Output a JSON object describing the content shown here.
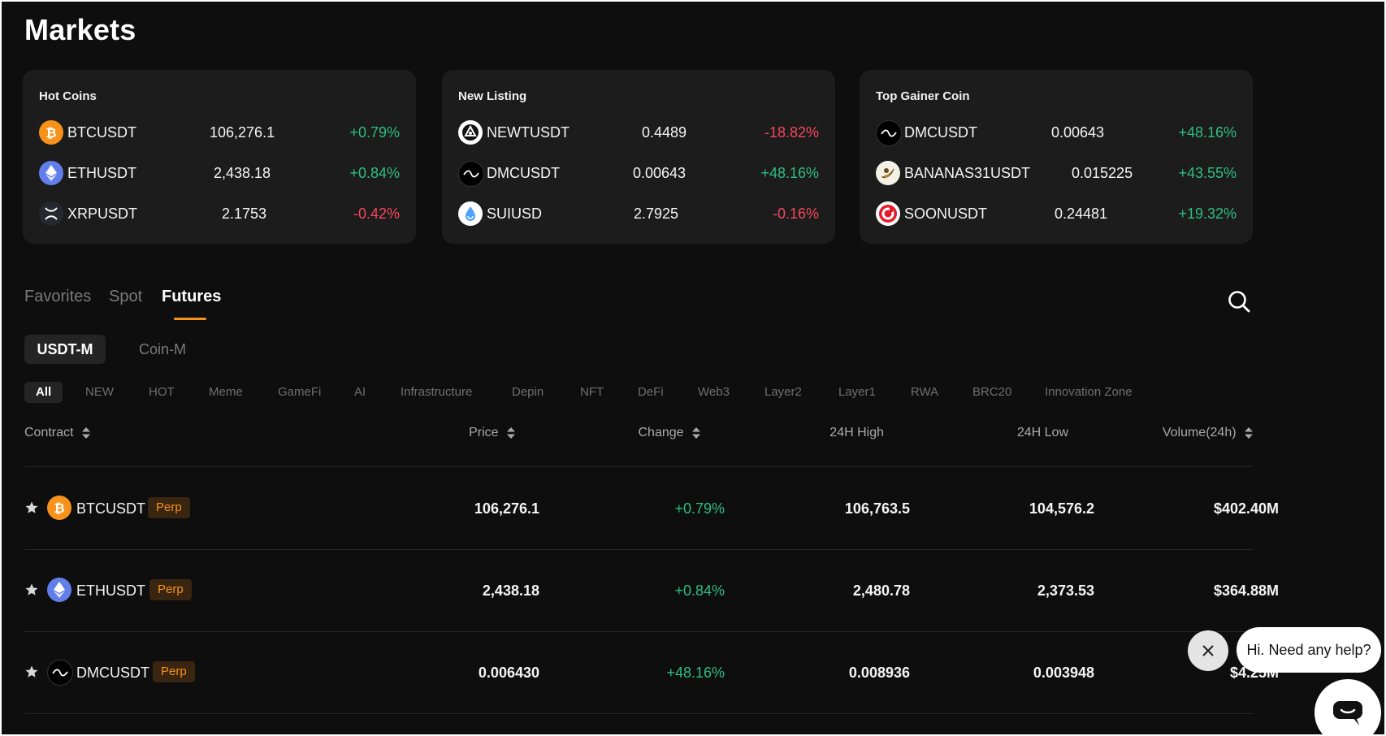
{
  "page": {
    "title": "Markets"
  },
  "cards": [
    {
      "title": "Hot Coins",
      "rows": [
        {
          "symbol": "BTCUSDT",
          "price": "106,276.1",
          "change": "+0.79%",
          "dir": "up",
          "icon": "bitcoin-icon"
        },
        {
          "symbol": "ETHUSDT",
          "price": "2,438.18",
          "change": "+0.84%",
          "dir": "up",
          "icon": "ethereum-icon"
        },
        {
          "symbol": "XRPUSDT",
          "price": "2.1753",
          "change": "-0.42%",
          "dir": "down",
          "icon": "xrp-icon"
        }
      ]
    },
    {
      "title": "New Listing",
      "rows": [
        {
          "symbol": "NEWTUSDT",
          "price": "0.4489",
          "change": "-18.82%",
          "dir": "down",
          "icon": "newt-icon"
        },
        {
          "symbol": "DMCUSDT",
          "price": "0.00643",
          "change": "+48.16%",
          "dir": "up",
          "icon": "dmc-icon"
        },
        {
          "symbol": "SUIUSD",
          "price": "2.7925",
          "change": "-0.16%",
          "dir": "down",
          "icon": "sui-icon"
        }
      ]
    },
    {
      "title": "Top Gainer Coin",
      "rows": [
        {
          "symbol": "DMCUSDT",
          "price": "0.00643",
          "change": "+48.16%",
          "dir": "up",
          "icon": "dmc-icon"
        },
        {
          "symbol": "BANANAS31USDT",
          "price": "0.015225",
          "change": "+43.55%",
          "dir": "up",
          "icon": "bananas31-icon"
        },
        {
          "symbol": "SOONUSDT",
          "price": "0.24481",
          "change": "+19.32%",
          "dir": "up",
          "icon": "soon-icon"
        }
      ]
    }
  ],
  "tabs": [
    {
      "label": "Favorites",
      "active": false
    },
    {
      "label": "Spot",
      "active": false
    },
    {
      "label": "Futures",
      "active": true
    }
  ],
  "segments": [
    {
      "label": "USDT-M",
      "active": true
    },
    {
      "label": "Coin-M",
      "active": false
    }
  ],
  "categories": [
    "All",
    "NEW",
    "HOT",
    "Meme",
    "GameFi",
    "AI",
    "Infrastructure",
    "Depin",
    "NFT",
    "DeFi",
    "Web3",
    "Layer2",
    "Layer1",
    "RWA",
    "BRC20",
    "Innovation Zone"
  ],
  "table": {
    "headers": {
      "contract": "Contract",
      "price": "Price",
      "change": "Change",
      "high": "24H High",
      "low": "24H Low",
      "volume": "Volume(24h)"
    },
    "perp_label": "Perp",
    "rows": [
      {
        "symbol": "BTCUSDT",
        "price": "106,276.1",
        "change": "+0.79%",
        "high": "106,763.5",
        "low": "104,576.2",
        "volume": "$402.40M",
        "icon": "bitcoin-icon"
      },
      {
        "symbol": "ETHUSDT",
        "price": "2,438.18",
        "change": "+0.84%",
        "high": "2,480.78",
        "low": "2,373.53",
        "volume": "$364.88M",
        "icon": "ethereum-icon"
      },
      {
        "symbol": "DMCUSDT",
        "price": "0.006430",
        "change": "+48.16%",
        "high": "0.008936",
        "low": "0.003948",
        "volume": "$4.25M",
        "icon": "dmc-icon"
      }
    ]
  },
  "help": {
    "message": "Hi. Need any help?"
  },
  "colors": {
    "up": "#2ebd85",
    "down": "#f6465d",
    "accent": "#f7931a",
    "background": "#0e0e0e",
    "card": "#1c1c1c"
  }
}
